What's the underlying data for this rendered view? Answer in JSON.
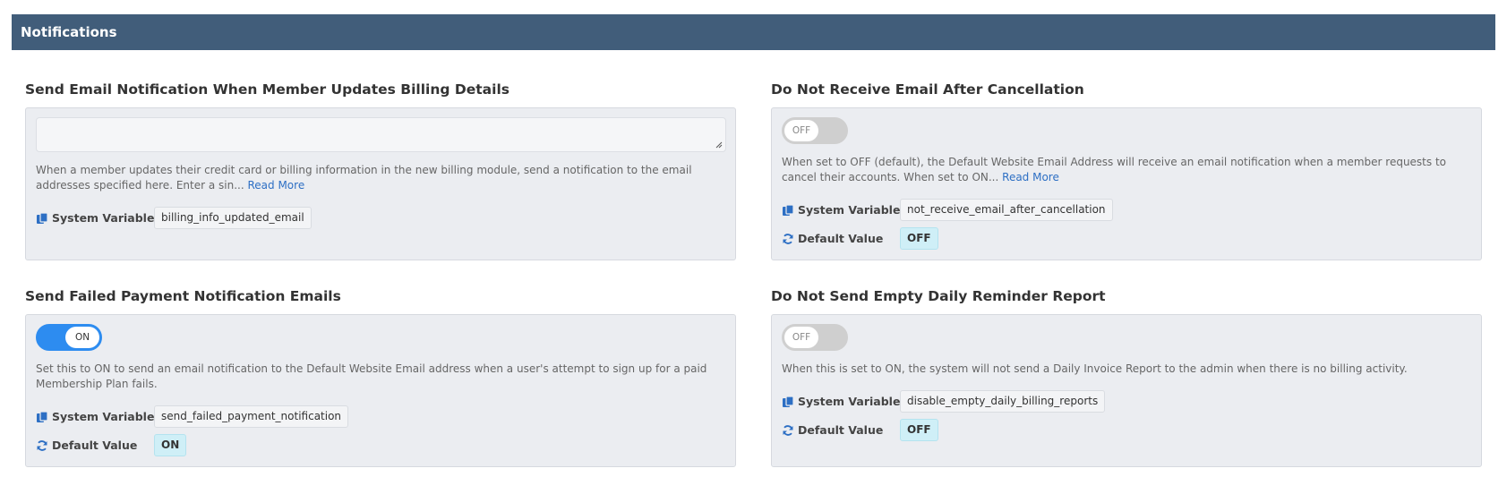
{
  "header": {
    "title": "Notifications"
  },
  "settings": [
    {
      "title": "Send Email Notification When Member Updates Billing Details",
      "control": "textarea",
      "textarea_value": "",
      "description": "When a member updates their credit card or billing information in the new billing module, send a notification to the email addresses specified here. Enter a sin...",
      "read_more": "Read More",
      "system_variable_label": "System Variable",
      "system_variable": "billing_info_updated_email"
    },
    {
      "title": "Do Not Receive Email After Cancellation",
      "control": "toggle",
      "toggle_state": "OFF",
      "description": "When set to OFF (default), the Default Website Email Address will receive an email notification when a member requests to cancel their accounts.  When set to ON...",
      "read_more": "Read More",
      "system_variable_label": "System Variable",
      "system_variable": "not_receive_email_after_cancellation",
      "default_value_label": "Default Value",
      "default_value": "OFF"
    },
    {
      "title": "Send Failed Payment Notification Emails",
      "control": "toggle",
      "toggle_state": "ON",
      "description": "Set this to ON to send an email notification to the Default Website Email address when a user's attempt to sign up for a paid Membership Plan fails.",
      "system_variable_label": "System Variable",
      "system_variable": "send_failed_payment_notification",
      "default_value_label": "Default Value",
      "default_value": "ON"
    },
    {
      "title": "Do Not Send Empty Daily Reminder Report",
      "control": "toggle",
      "toggle_state": "OFF",
      "description": "When this is set to ON, the system will not send a Daily Invoice Report to the admin when there is no billing activity.",
      "system_variable_label": "System Variable",
      "system_variable": "disable_empty_daily_billing_reports",
      "default_value_label": "Default Value",
      "default_value": "OFF"
    }
  ],
  "colors": {
    "header_bg": "#415d7a",
    "toggle_on": "#2d8cf0",
    "toggle_off": "#cfcfcf",
    "link": "#2d6fc4",
    "default_chip": "#cfeff7"
  }
}
